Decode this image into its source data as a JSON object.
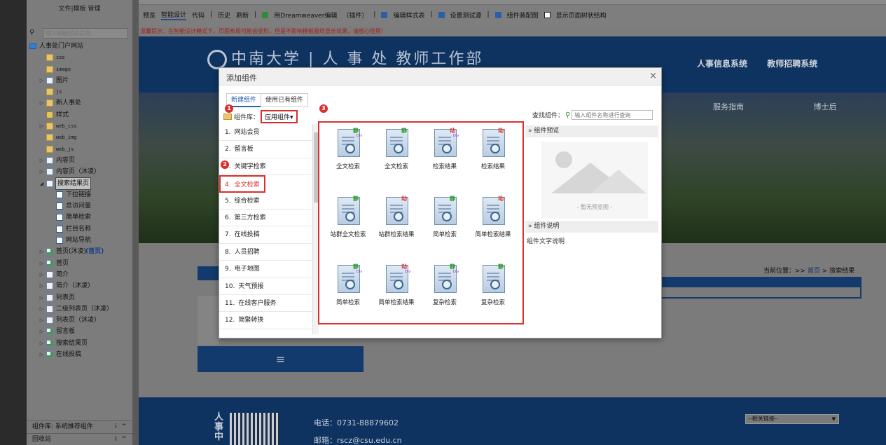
{
  "sidebar": {
    "title": "文件|模板 管理",
    "search_placeholder": "输入模板相关信息",
    "tree": [
      {
        "label": "人事处门户网站",
        "indent": 0,
        "icon": "site",
        "tog": ""
      },
      {
        "label": "css",
        "indent": 1,
        "icon": "folder",
        "tog": "",
        "mono": true
      },
      {
        "label": "image",
        "indent": 1,
        "icon": "folder",
        "tog": "",
        "mono": true
      },
      {
        "label": "图片",
        "indent": 1,
        "icon": "page",
        "tog": "▷"
      },
      {
        "label": "js",
        "indent": 1,
        "icon": "folder",
        "tog": "",
        "mono": true
      },
      {
        "label": "新人事处",
        "indent": 1,
        "icon": "folder",
        "tog": "▷"
      },
      {
        "label": "样式",
        "indent": 1,
        "icon": "star",
        "tog": ""
      },
      {
        "label": "web_css",
        "indent": 1,
        "icon": "folder",
        "tog": "▷",
        "mono": true
      },
      {
        "label": "web_img",
        "indent": 1,
        "icon": "folder",
        "tog": "",
        "mono": true
      },
      {
        "label": "web_js",
        "indent": 1,
        "icon": "folder",
        "tog": "",
        "mono": true
      },
      {
        "label": "内容页",
        "indent": 1,
        "icon": "page",
        "tog": "▷"
      },
      {
        "label": "内容页（沐凌）",
        "indent": 1,
        "icon": "page",
        "tog": "▷"
      },
      {
        "label": "搜索结果页",
        "indent": 1,
        "icon": "page",
        "tog": "◢",
        "selected": true
      },
      {
        "label": "下拉链接",
        "indent": 2,
        "icon": "comp",
        "tog": ""
      },
      {
        "label": "总访问量",
        "indent": 2,
        "icon": "comp",
        "tog": ""
      },
      {
        "label": "简单检索",
        "indent": 2,
        "icon": "comp",
        "tog": ""
      },
      {
        "label": "栏目名称",
        "indent": 2,
        "icon": "comp",
        "tog": ""
      },
      {
        "label": "网站导航",
        "indent": 2,
        "icon": "comp",
        "tog": ""
      },
      {
        "label": "首页(沐凌)",
        "suffix": "(首页)",
        "indent": 1,
        "icon": "homep",
        "tog": "▷"
      },
      {
        "label": "首页",
        "indent": 1,
        "icon": "homep",
        "tog": "▷"
      },
      {
        "label": "简介",
        "indent": 1,
        "icon": "page",
        "tog": "▷"
      },
      {
        "label": "简介（沐凌）",
        "indent": 1,
        "icon": "page",
        "tog": "▷"
      },
      {
        "label": "列表页",
        "indent": 1,
        "icon": "page",
        "tog": "▷"
      },
      {
        "label": "二级列表页（沐凌）",
        "indent": 1,
        "icon": "page",
        "tog": "▷"
      },
      {
        "label": "列表页（沐凌）",
        "indent": 1,
        "icon": "page",
        "tog": "▷"
      },
      {
        "label": "留言板",
        "indent": 1,
        "icon": "homep",
        "tog": "▷"
      },
      {
        "label": "搜索结果页",
        "indent": 1,
        "icon": "homep",
        "tog": "▷"
      },
      {
        "label": "在线投稿",
        "indent": 1,
        "icon": "homep",
        "tog": "▷"
      }
    ],
    "footer1": "组件库: 系统推荐组件",
    "footer1_icons": "i ^",
    "footer2": "回收站",
    "footer2_icons": "i ^"
  },
  "toolbar": {
    "items": [
      "预览",
      "智能设计",
      "代码",
      "|",
      "历史",
      "刷新",
      "|",
      "用Dreamweaver编辑",
      "（插件）",
      "|",
      "编辑样式表",
      "|",
      "设置测试源",
      "|",
      "组件装配图",
      "显示页面树状结构"
    ]
  },
  "tip": "温馨提示：在智能设计模式下，页面布局可能会变形，但是不影响模板最终显示效果，请放心使用!",
  "page": {
    "logo_cn": "中南大学",
    "logo_sep": "|",
    "logo_dept": "人 事 处 教师工作部",
    "nav1": [
      "人事信息系统",
      "教师招聘系统"
    ],
    "nav2": [
      "服务指南",
      "博士后"
    ],
    "breadcrumb_prefix": "当前位置：>>",
    "breadcrumb_home": "首页",
    "breadcrumb_sep": ">",
    "breadcrumb_current": "搜索结果",
    "menu_icon": "≡",
    "footer_title": "人事中",
    "phone": "电话：0731-88879602",
    "email": "邮箱：rscz@csu.edu.cn",
    "link_select": "--相关链接--"
  },
  "dialog": {
    "title": "添加组件",
    "close": "×",
    "tabs": [
      "新建组件",
      "使用已有组件"
    ],
    "lib_label": "组件库：",
    "lib_value": "应用组件",
    "lib_caret": "▾",
    "search_label": "查找组件：",
    "search_placeholder": "输入组件名称进行查询",
    "categories": [
      {
        "num": "1.",
        "label": "网站会员"
      },
      {
        "num": "2.",
        "label": "留言板"
      },
      {
        "num": "3.",
        "label": "关键字检索"
      },
      {
        "num": "4.",
        "label": "全文检索",
        "active": true
      },
      {
        "num": "5.",
        "label": "综合检索"
      },
      {
        "num": "6.",
        "label": "第三方检索"
      },
      {
        "num": "7.",
        "label": "在线投稿"
      },
      {
        "num": "8.",
        "label": "人员招聘"
      },
      {
        "num": "9.",
        "label": "电子地图"
      },
      {
        "num": "10.",
        "label": "天气预报"
      },
      {
        "num": "11.",
        "label": "在线客户服务"
      },
      {
        "num": "12.",
        "label": "简繁转换"
      }
    ],
    "components": [
      {
        "name": "全文检索",
        "tag": "静",
        "div": "Div",
        "kind": "s"
      },
      {
        "name": "全文检索",
        "tag": "静",
        "div": "",
        "kind": "s"
      },
      {
        "name": "检索结果",
        "tag": "动",
        "div": "Div",
        "kind": "d"
      },
      {
        "name": "检索结果",
        "tag": "动",
        "div": "",
        "kind": "d"
      },
      {
        "name": "站群全文检索",
        "tag": "静",
        "div": "",
        "kind": "s"
      },
      {
        "name": "站群检索结果",
        "tag": "动",
        "div": "",
        "kind": "d"
      },
      {
        "name": "简单检索",
        "tag": "静",
        "div": "",
        "kind": "s"
      },
      {
        "name": "简单检索结果",
        "tag": "动",
        "div": "",
        "kind": "d"
      },
      {
        "name": "简单检索",
        "tag": "静",
        "div": "Div",
        "kind": "s"
      },
      {
        "name": "简单检索结果",
        "tag": "动",
        "div": "Div",
        "kind": "d"
      },
      {
        "name": "复杂检索",
        "tag": "静",
        "div": "Div",
        "kind": "s"
      },
      {
        "name": "复杂检索",
        "tag": "静",
        "div": "",
        "kind": "s"
      },
      {
        "name": "",
        "tag": "动",
        "div": "",
        "kind": "d"
      },
      {
        "name": "",
        "tag": "动",
        "div": "",
        "kind": "d"
      }
    ],
    "preview_header": "» 组件预览",
    "preview_none": "- 暂无预览图 -",
    "desc_header": "» 组件说明",
    "desc_text": "组件文字说明",
    "badges": [
      "1",
      "2",
      "3"
    ]
  },
  "colors": {
    "accent_red": "#d9302d",
    "tab_blue": "#2961b0",
    "site_navy": "#123a6d"
  }
}
